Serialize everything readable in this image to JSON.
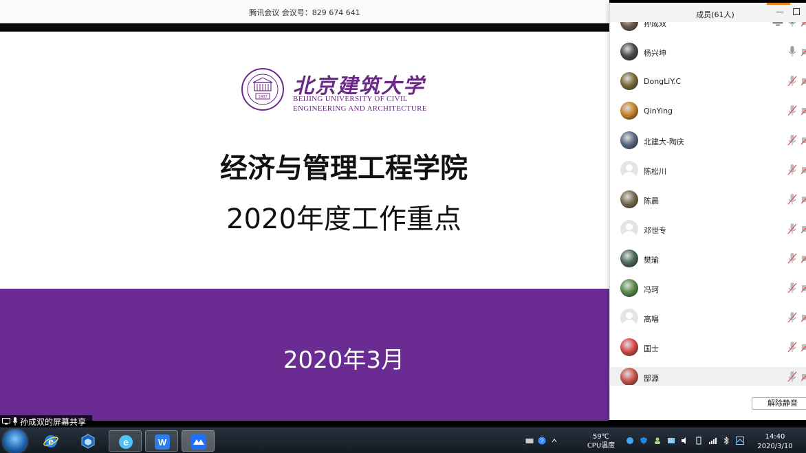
{
  "meeting": {
    "title": "腾讯会议 会议号：829 674 641"
  },
  "slide": {
    "logo_cn": "北京建筑大学",
    "logo_en_line1": "BEIJING UNIVERSITY OF CIVIL",
    "logo_en_line2": "ENGINEERING AND ARCHITECTURE",
    "seal_year": "1907",
    "title": "经济与管理工程学院",
    "subtitle": "2020年度工作重点",
    "date": "2020年3月",
    "accent_color": "#6a2c92"
  },
  "share": {
    "label": "孙成双的屏幕共享"
  },
  "members": {
    "title": "成员(61人)",
    "unmute_all_label": "解除静音",
    "list": [
      {
        "name": "孙成双",
        "mic": "on",
        "sharing": true,
        "avatar": "photo"
      },
      {
        "name": "杨兴坤",
        "mic": "on",
        "sharing": false,
        "avatar": "photo"
      },
      {
        "name": "DongLiY.C",
        "mic": "muted",
        "sharing": false,
        "avatar": "photo"
      },
      {
        "name": "QinYing",
        "mic": "muted",
        "sharing": false,
        "avatar": "photo"
      },
      {
        "name": "北建大-陶庆",
        "mic": "muted",
        "sharing": false,
        "avatar": "photo"
      },
      {
        "name": "陈松川",
        "mic": "muted",
        "sharing": false,
        "avatar": "default"
      },
      {
        "name": "陈晨",
        "mic": "muted",
        "sharing": false,
        "avatar": "photo"
      },
      {
        "name": "邓世专",
        "mic": "muted",
        "sharing": false,
        "avatar": "default"
      },
      {
        "name": "樊瑜",
        "mic": "muted",
        "sharing": false,
        "avatar": "photo"
      },
      {
        "name": "冯珂",
        "mic": "muted",
        "sharing": false,
        "avatar": "photo"
      },
      {
        "name": "高唱",
        "mic": "muted",
        "sharing": false,
        "avatar": "default"
      },
      {
        "name": "国士",
        "mic": "muted",
        "sharing": false,
        "avatar": "photo"
      },
      {
        "name": "郜源",
        "mic": "muted",
        "sharing": false,
        "avatar": "photo"
      }
    ]
  },
  "taskbar": {
    "apps": [
      "start-orb",
      "internet-explorer",
      "virtualbox",
      "360-browser",
      "wps-writer",
      "tencent-meeting"
    ],
    "temperature": "59℃",
    "temperature_label": "CPU温度",
    "time": "14:40",
    "date": "2020/3/10"
  }
}
